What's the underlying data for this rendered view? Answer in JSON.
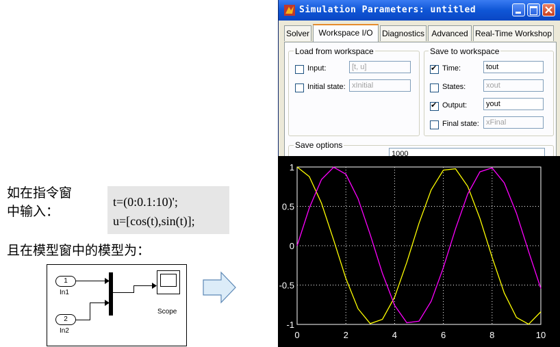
{
  "slide": {
    "line1": "如在指令窗",
    "line2": "中输入：",
    "line3": "且在模型窗中的模型为：",
    "code1": "t=(0:0.1:10)';",
    "code2": "u=[cos(t),sin(t)];"
  },
  "model": {
    "in1_number": "1",
    "in1_label": "In1",
    "in2_number": "2",
    "in2_label": "In2",
    "scope_label": "Scope"
  },
  "dialog": {
    "title": "Simulation Parameters: untitled",
    "tabs": [
      {
        "label": "Solver"
      },
      {
        "label": "Workspace I/O"
      },
      {
        "label": "Diagnostics"
      },
      {
        "label": "Advanced"
      },
      {
        "label": "Real-Time Workshop"
      }
    ],
    "load": {
      "title": "Load from workspace",
      "input_label": "Input:",
      "input_value": "[t, u]",
      "input_checked": false,
      "initial_label": "Initial state:",
      "initial_value": "xInitial",
      "initial_checked": false
    },
    "save": {
      "title": "Save to workspace",
      "time_label": "Time:",
      "time_value": "tout",
      "time_checked": true,
      "states_label": "States:",
      "states_value": "xout",
      "states_checked": false,
      "output_label": "Output:",
      "output_value": "yout",
      "output_checked": true,
      "final_label": "Final state:",
      "final_value": "xFinal",
      "final_checked": false
    },
    "save_options": {
      "title": "Save options",
      "partial_value": "1000"
    }
  },
  "colors": {
    "yellow_series": "#ffff00",
    "magenta_series": "#ff00ff",
    "plot_bg": "#000000",
    "arrow_fill": "#dcecf8",
    "arrow_stroke": "#5b87b5"
  },
  "chart_data": {
    "type": "line",
    "x_range": [
      0,
      10
    ],
    "ylim": [
      -1,
      1
    ],
    "x_ticks": [
      "0",
      "2",
      "4",
      "6",
      "8",
      "10"
    ],
    "y_ticks": [
      "1",
      "0.5",
      "0",
      "-0.5",
      "-1"
    ],
    "grid": true,
    "x": [
      0,
      0.5,
      1,
      1.5,
      2,
      2.5,
      3,
      3.5,
      4,
      4.5,
      5,
      5.5,
      6,
      6.5,
      7,
      7.5,
      8,
      8.5,
      9,
      9.5,
      10
    ],
    "series": [
      {
        "color": "#ffff00",
        "values": [
          1,
          0.878,
          0.54,
          0.071,
          -0.416,
          -0.801,
          -0.99,
          -0.936,
          -0.654,
          -0.211,
          0.284,
          0.709,
          0.96,
          0.977,
          0.754,
          0.347,
          -0.146,
          -0.602,
          -0.911,
          -0.997,
          -0.839
        ]
      },
      {
        "color": "#ff00ff",
        "values": [
          0,
          0.479,
          0.841,
          0.997,
          0.909,
          0.598,
          0.141,
          -0.351,
          -0.757,
          -0.978,
          -0.959,
          -0.706,
          -0.279,
          0.215,
          0.657,
          0.938,
          0.989,
          0.798,
          0.412,
          -0.075,
          -0.544
        ]
      }
    ]
  }
}
